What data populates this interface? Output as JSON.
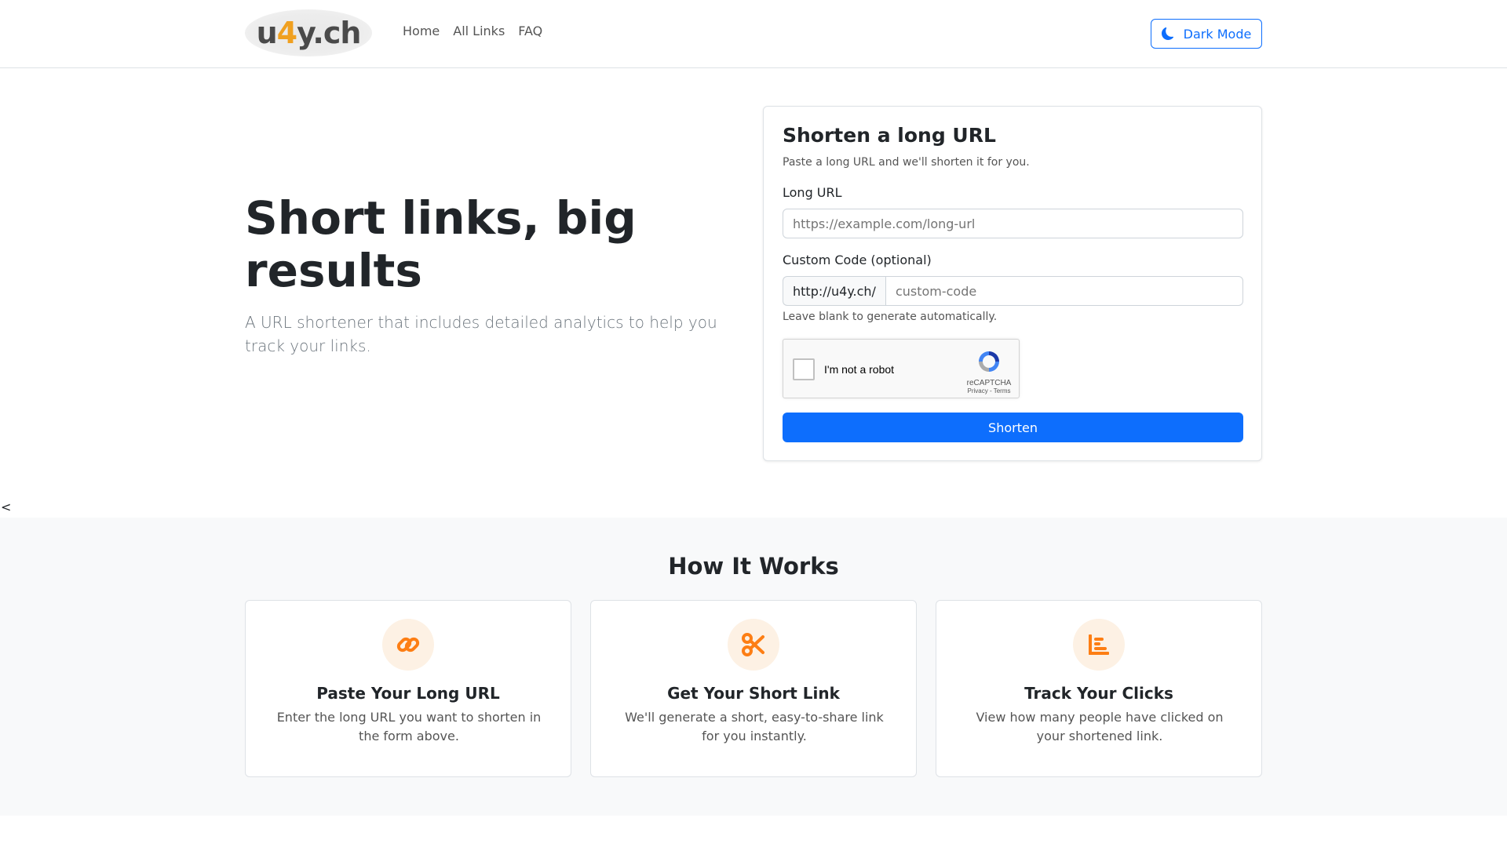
{
  "navbar": {
    "logo": {
      "part1": "u",
      "accent": "4",
      "part2": "y.ch"
    },
    "links": [
      "Home",
      "All Links",
      "FAQ"
    ],
    "dark_mode_label": "Dark Mode"
  },
  "hero": {
    "title": "Short links, big results",
    "subtitle": "A URL shortener that includes detailed analytics to help you track your links."
  },
  "form": {
    "title": "Shorten a long URL",
    "description": "Paste a long URL and we'll shorten it for you.",
    "long_url_label": "Long URL",
    "long_url_placeholder": "https://example.com/long-url",
    "custom_code_label": "Custom Code (optional)",
    "custom_code_prefix": "http://u4y.ch/",
    "custom_code_placeholder": "custom-code",
    "custom_code_hint": "Leave blank to generate automatically.",
    "captcha": {
      "label": "I'm not a robot",
      "brand": "reCAPTCHA",
      "links": "Privacy - Terms"
    },
    "submit_label": "Shorten"
  },
  "stray_text": "<",
  "how_it_works": {
    "title": "How It Works",
    "steps": [
      {
        "icon": "link-icon",
        "title": "Paste Your Long URL",
        "desc": "Enter the long URL you want to shorten in the form above."
      },
      {
        "icon": "scissors-icon",
        "title": "Get Your Short Link",
        "desc": "We'll generate a short, easy-to-share link for you instantly."
      },
      {
        "icon": "bar-chart-icon",
        "title": "Track Your Clicks",
        "desc": "View how many people have clicked on your shortened link."
      }
    ]
  },
  "colors": {
    "primary": "#0d6efd",
    "accent_orange": "#f0a020",
    "icon_orange": "#fd7e14",
    "icon_bg": "#fdf1e4"
  }
}
